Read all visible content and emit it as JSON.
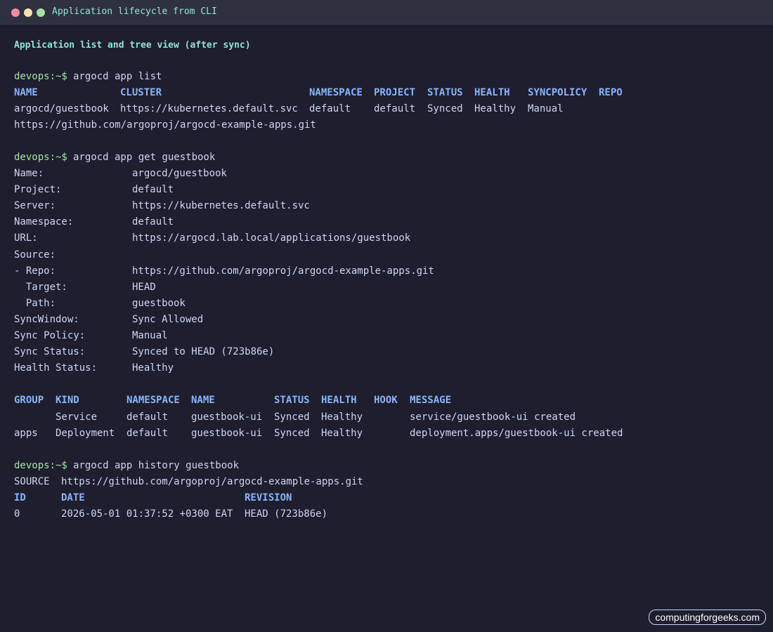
{
  "window": {
    "title": "Application lifecycle from CLI"
  },
  "heading": "Application list and tree view (after sync)",
  "prompt": "devops:~$",
  "app_list": {
    "command": "argocd app list",
    "headers": [
      "NAME",
      "CLUSTER",
      "NAMESPACE",
      "PROJECT",
      "STATUS",
      "HEALTH",
      "SYNCPOLICY",
      "REPO"
    ],
    "row": [
      "argocd/guestbook",
      "https://kubernetes.default.svc",
      "default",
      "default",
      "Synced",
      "Healthy",
      "Manual"
    ],
    "repo_wrapped": "https://github.com/argoproj/argocd-example-apps.git"
  },
  "app_get": {
    "command": "argocd app get guestbook",
    "fields": [
      {
        "key": "Name:",
        "value": "argocd/guestbook"
      },
      {
        "key": "Project:",
        "value": "default"
      },
      {
        "key": "Server:",
        "value": "https://kubernetes.default.svc"
      },
      {
        "key": "Namespace:",
        "value": "default"
      },
      {
        "key": "URL:",
        "value": "https://argocd.lab.local/applications/guestbook"
      },
      {
        "key": "Source:",
        "value": ""
      },
      {
        "key": "- Repo:",
        "value": "https://github.com/argoproj/argocd-example-apps.git"
      },
      {
        "key": "  Target:",
        "value": "HEAD"
      },
      {
        "key": "  Path:",
        "value": "guestbook"
      },
      {
        "key": "SyncWindow:",
        "value": "Sync Allowed"
      },
      {
        "key": "Sync Policy:",
        "value": "Manual"
      },
      {
        "key": "Sync Status:",
        "value": "Synced to HEAD (723b86e)"
      },
      {
        "key": "Health Status:",
        "value": "Healthy"
      }
    ],
    "resource_headers": [
      "GROUP",
      "KIND",
      "NAMESPACE",
      "NAME",
      "STATUS",
      "HEALTH",
      "HOOK",
      "MESSAGE"
    ],
    "resources": [
      [
        "",
        "Service",
        "default",
        "guestbook-ui",
        "Synced",
        "Healthy",
        "",
        "service/guestbook-ui created"
      ],
      [
        "apps",
        "Deployment",
        "default",
        "guestbook-ui",
        "Synced",
        "Healthy",
        "",
        "deployment.apps/guestbook-ui created"
      ]
    ]
  },
  "app_history": {
    "command": "argocd app history guestbook",
    "source_label": "SOURCE",
    "source_value": "https://github.com/argoproj/argocd-example-apps.git",
    "headers": [
      "ID",
      "DATE",
      "REVISION"
    ],
    "rows": [
      [
        "0",
        "2026-05-01 01:37:52 +0300 EAT",
        "HEAD (723b86e)"
      ]
    ]
  },
  "watermark": "computingforgeeks.com"
}
